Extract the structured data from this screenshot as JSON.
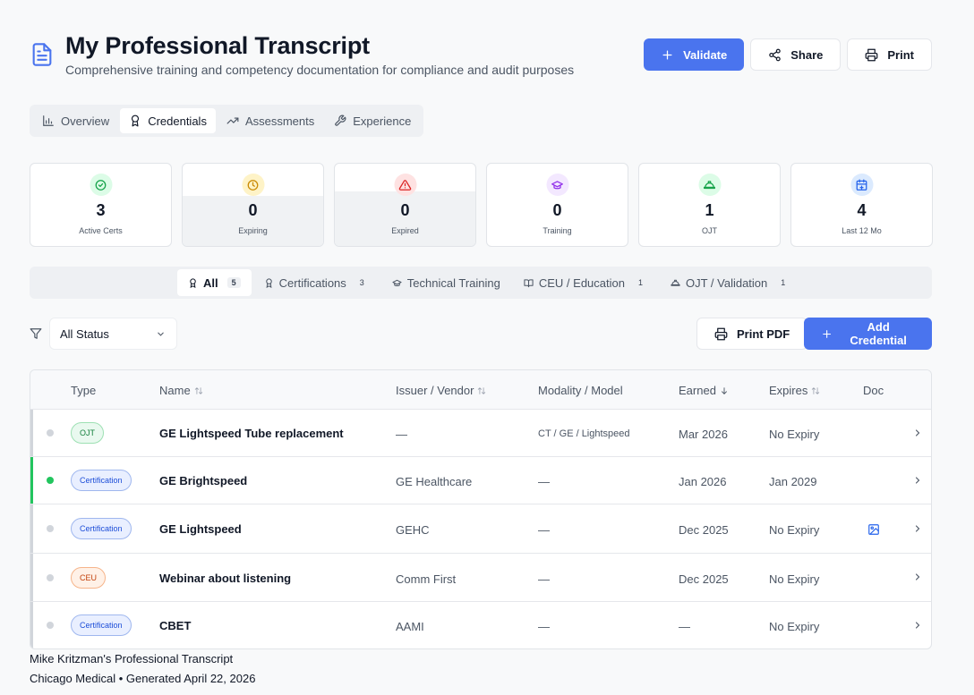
{
  "header": {
    "title": "My Professional Transcript",
    "subtitle": "Comprehensive training and competency documentation for compliance and audit purposes",
    "validate_label": "Validate",
    "share_label": "Share",
    "print_label": "Print"
  },
  "view_tabs": [
    {
      "label": "Overview",
      "icon": "bar-chart-icon"
    },
    {
      "label": "Credentials",
      "icon": "award-icon",
      "active": true
    },
    {
      "label": "Assessments",
      "icon": "trending-up-icon"
    },
    {
      "label": "Experience",
      "icon": "wrench-icon"
    }
  ],
  "stats": [
    {
      "value": "3",
      "label": "Active Certs",
      "icon": "check-circle-icon",
      "color": "#16a34a"
    },
    {
      "value": "0",
      "label": "Expiring",
      "icon": "clock-icon",
      "color": "#ca8a04"
    },
    {
      "value": "0",
      "label": "Expired",
      "icon": "alert-triangle-icon",
      "color": "#dc2626"
    },
    {
      "value": "0",
      "label": "Training",
      "icon": "graduation-cap-icon",
      "color": "#9333ea"
    },
    {
      "value": "1",
      "label": "OJT",
      "icon": "hard-hat-icon",
      "color": "#16a34a"
    },
    {
      "value": "4",
      "label": "Last 12 Mo",
      "icon": "calendar-plus-icon",
      "color": "#2563eb"
    }
  ],
  "filter_tabs": [
    {
      "label": "All",
      "count": "5",
      "icon": "award-icon",
      "active": true
    },
    {
      "label": "Certifications",
      "count": "3",
      "icon": "award-icon"
    },
    {
      "label": "Technical Training",
      "count": "",
      "icon": "graduation-cap-icon"
    },
    {
      "label": "CEU / Education",
      "count": "1",
      "icon": "book-open-icon"
    },
    {
      "label": "OJT / Validation",
      "count": "1",
      "icon": "hard-hat-icon"
    }
  ],
  "toolbar": {
    "status_value": "All Status",
    "print_pdf_label": "Print PDF",
    "add_label": "Add Credential"
  },
  "table": {
    "headers": {
      "type": "Type",
      "name": "Name",
      "issuer": "Issuer / Vendor",
      "modality": "Modality / Model",
      "earned": "Earned",
      "expires": "Expires",
      "doc": "Doc"
    },
    "rows": [
      {
        "status": "inactive",
        "type": "OJT",
        "name": "GE Lightspeed Tube replacement",
        "issuer": "—",
        "modality": "CT / GE / Lightspeed",
        "earned": "Mar 2026",
        "expires": "No Expiry",
        "doc": false
      },
      {
        "status": "active",
        "type": "Certification",
        "name": "GE Brightspeed",
        "issuer": "GE Healthcare",
        "modality": "—",
        "earned": "Jan 2026",
        "expires": "Jan 2029",
        "doc": false
      },
      {
        "status": "inactive",
        "type": "Certification",
        "name": "GE Lightspeed",
        "issuer": "GEHC",
        "modality": "—",
        "earned": "Dec 2025",
        "expires": "No Expiry",
        "doc": true
      },
      {
        "status": "inactive",
        "type": "CEU",
        "name": "Webinar about listening",
        "issuer": "Comm First",
        "modality": "—",
        "earned": "Dec 2025",
        "expires": "No Expiry",
        "doc": false
      },
      {
        "status": "inactive",
        "type": "Certification",
        "name": "CBET",
        "issuer": "AAMI",
        "modality": "—",
        "earned": "—",
        "expires": "No Expiry",
        "doc": false
      }
    ]
  },
  "footer": {
    "line1": "Mike Kritzman's Professional Transcript",
    "line2": "Chicago Medical • Generated April 22, 2026"
  }
}
